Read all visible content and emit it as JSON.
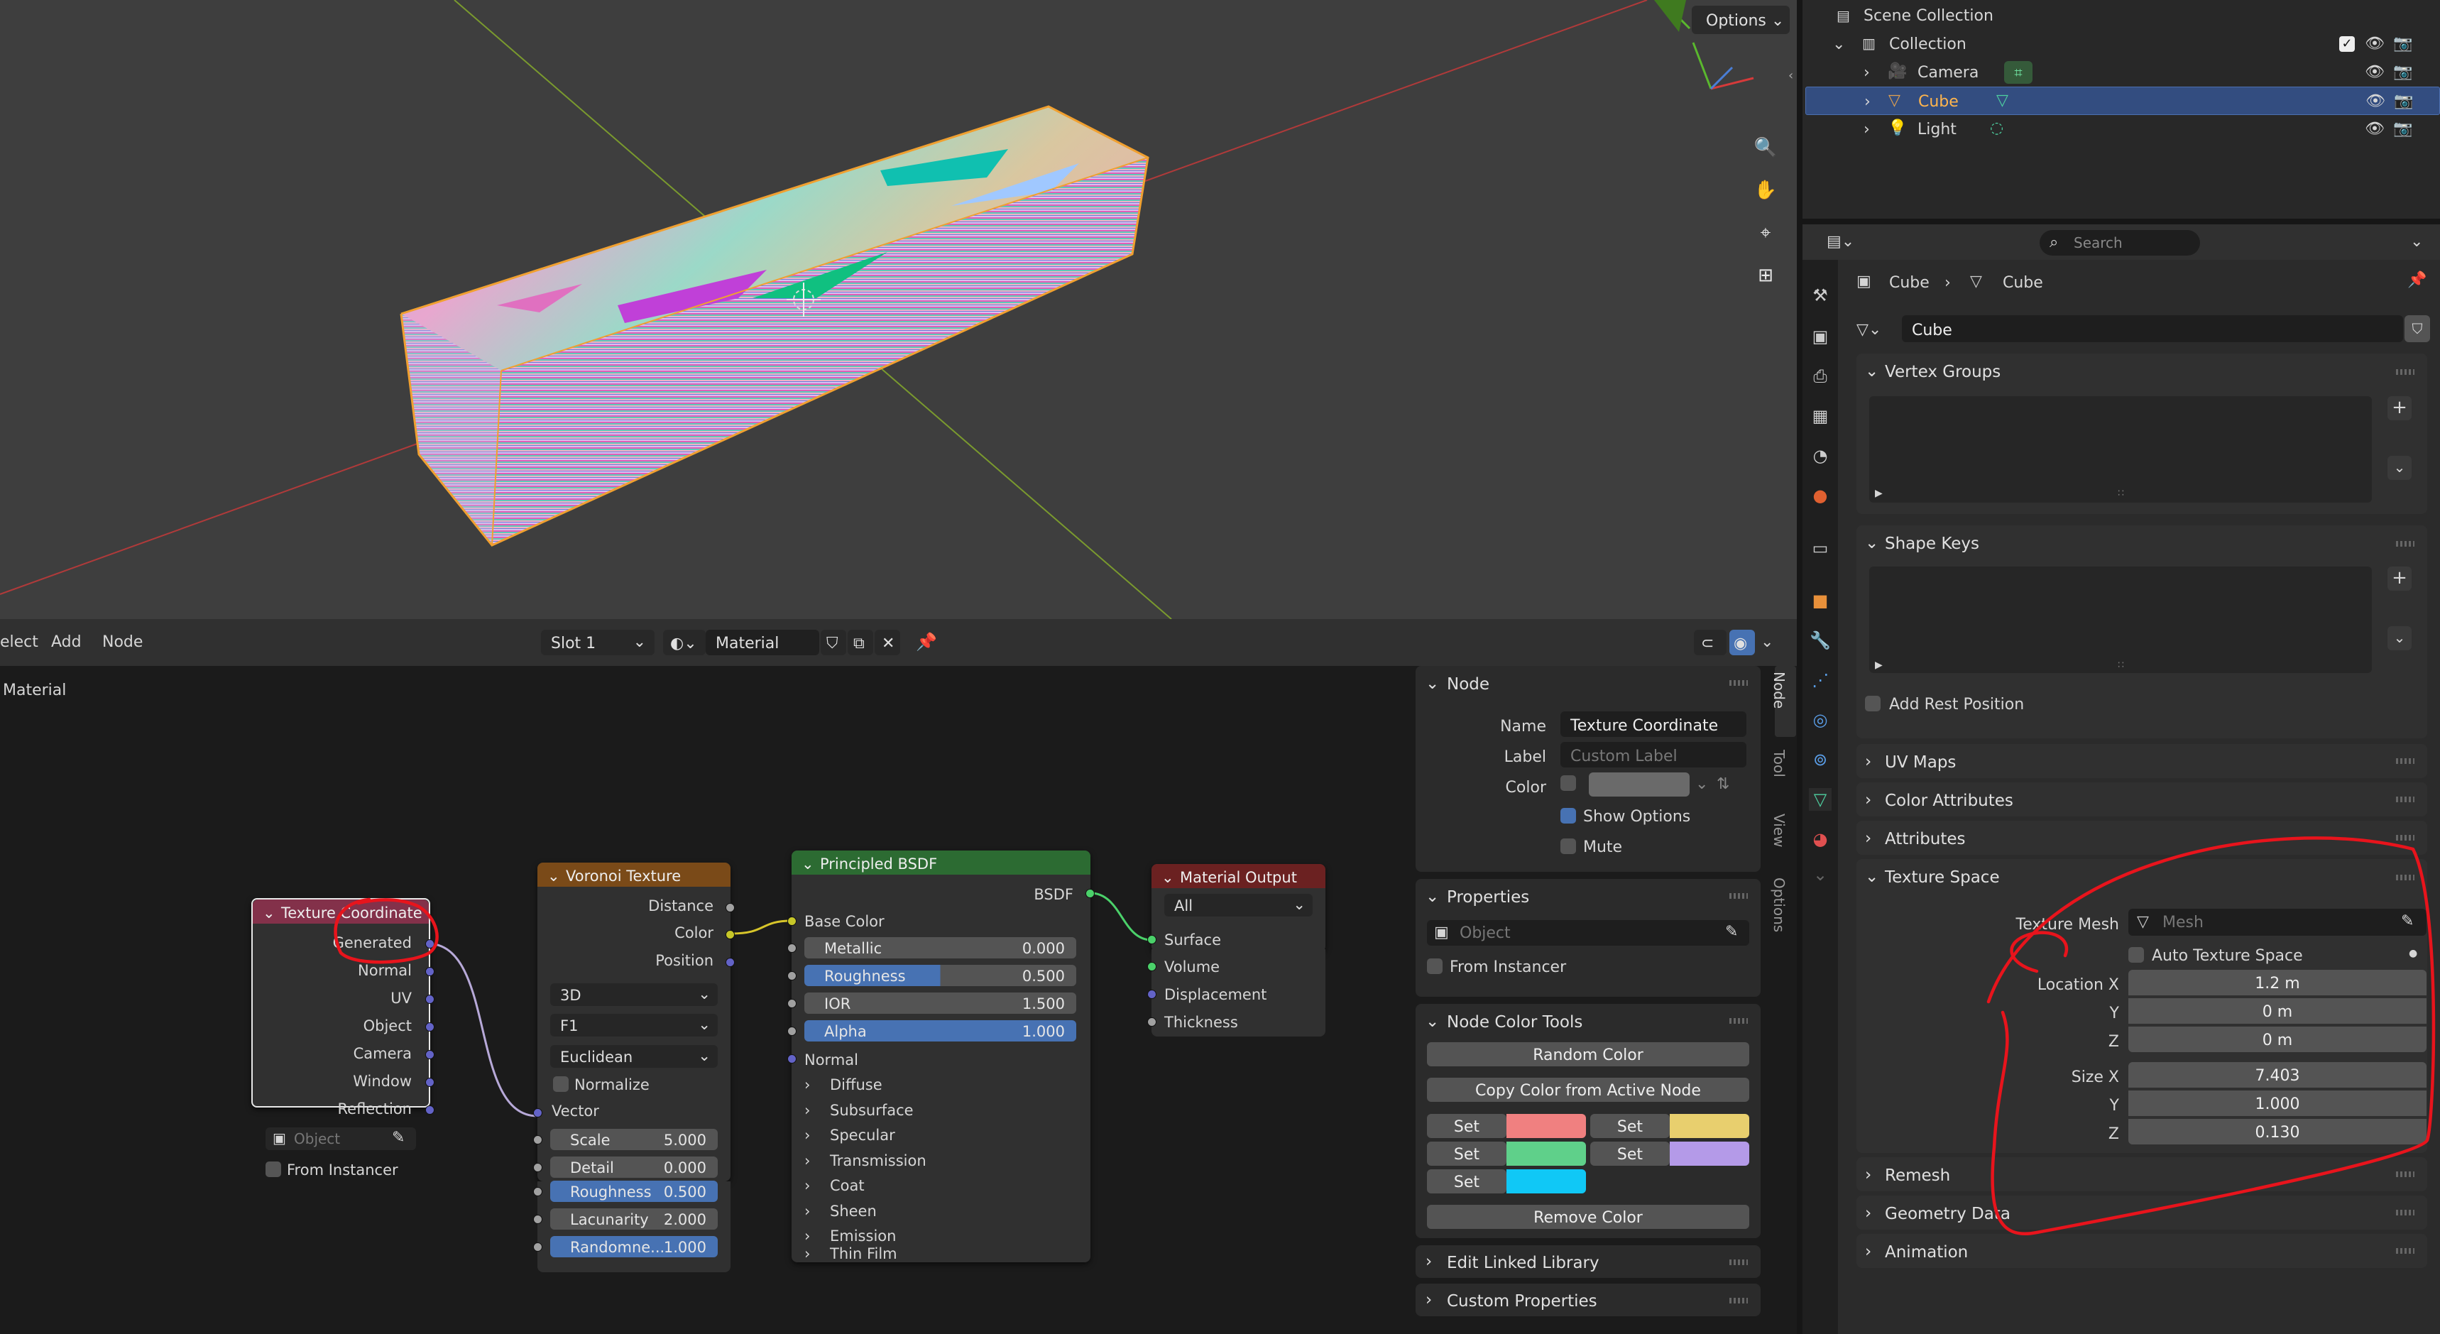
{
  "viewport": {
    "options_label": "Options"
  },
  "node_editor": {
    "header": {
      "menus": [
        "elect",
        "Add",
        "Node"
      ],
      "slot": "Slot 1",
      "material_name": "Material"
    },
    "breadcrumb": "Material",
    "nodes": {
      "texture_coordinate": {
        "title": "Texture Coordinate",
        "outputs": [
          "Generated",
          "Normal",
          "UV",
          "Object",
          "Camera",
          "Window",
          "Reflection"
        ],
        "object_placeholder": "Object",
        "from_instancer": "From Instancer"
      },
      "voronoi": {
        "title": "Voronoi Texture",
        "outputs": [
          "Distance",
          "Color",
          "Position"
        ],
        "dimensions": "3D",
        "feature": "F1",
        "metric": "Euclidean",
        "normalize": "Normalize",
        "vector": "Vector",
        "fields": [
          {
            "label": "Scale",
            "value": "5.000"
          },
          {
            "label": "Detail",
            "value": "0.000"
          },
          {
            "label": "Roughness",
            "value": "0.500"
          },
          {
            "label": "Lacunarity",
            "value": "2.000"
          },
          {
            "label": "Randomne...",
            "value": "1.000"
          }
        ]
      },
      "principled": {
        "title": "Principled BSDF",
        "output": "BSDF",
        "base_color": "Base Color",
        "fields": [
          {
            "label": "Metallic",
            "value": "0.000"
          },
          {
            "label": "Roughness",
            "value": "0.500"
          },
          {
            "label": "IOR",
            "value": "1.500"
          },
          {
            "label": "Alpha",
            "value": "1.000"
          }
        ],
        "normal": "Normal",
        "sections": [
          "Diffuse",
          "Subsurface",
          "Specular",
          "Transmission",
          "Coat",
          "Sheen",
          "Emission",
          "Thin Film"
        ]
      },
      "material_output": {
        "title": "Material Output",
        "target": "All",
        "inputs": [
          "Surface",
          "Volume",
          "Displacement",
          "Thickness"
        ]
      }
    },
    "sidebar": {
      "node_panel": {
        "title": "Node",
        "name_label": "Name",
        "name_value": "Texture Coordinate",
        "label_label": "Label",
        "label_placeholder": "Custom Label",
        "color_label": "Color",
        "show_options": "Show Options",
        "mute": "Mute"
      },
      "properties_panel": {
        "title": "Properties",
        "object_placeholder": "Object",
        "from_instancer": "From Instancer"
      },
      "color_tools": {
        "title": "Node Color Tools",
        "random": "Random Color",
        "copy": "Copy Color from Active Node",
        "set": "Set",
        "remove": "Remove Color",
        "swatches": [
          "#f08080",
          "#e8cf6e",
          "#5fd08a",
          "#b49ae8",
          "#10c8f6"
        ]
      },
      "edit_linked": "Edit Linked Library",
      "custom_props": "Custom Properties",
      "tabs": [
        "Node",
        "Tool",
        "View",
        "Options"
      ]
    }
  },
  "outliner": {
    "scene_collection": "Scene Collection",
    "collection": "Collection",
    "items": [
      {
        "name": "Camera",
        "selected": false
      },
      {
        "name": "Cube",
        "selected": true
      },
      {
        "name": "Light",
        "selected": false
      }
    ]
  },
  "properties": {
    "search_placeholder": "Search",
    "breadcrumb": [
      "Cube",
      "Cube"
    ],
    "mesh_name": "Cube",
    "panels": {
      "vertex_groups": "Vertex Groups",
      "shape_keys": "Shape Keys",
      "add_rest_position": "Add Rest Position",
      "uv_maps": "UV Maps",
      "color_attributes": "Color Attributes",
      "attributes": "Attributes",
      "texture_space": "Texture Space",
      "remesh": "Remesh",
      "geometry_data": "Geometry Data",
      "animation": "Animation"
    },
    "texture_space": {
      "texture_mesh_label": "Texture Mesh",
      "mesh_placeholder": "Mesh",
      "auto_label": "Auto Texture Space",
      "location_label": "Location X",
      "y_label": "Y",
      "z_label": "Z",
      "location": [
        "1.2 m",
        "0 m",
        "0 m"
      ],
      "size_label": "Size X",
      "size": [
        "7.403",
        "1.000",
        "0.130"
      ]
    }
  }
}
